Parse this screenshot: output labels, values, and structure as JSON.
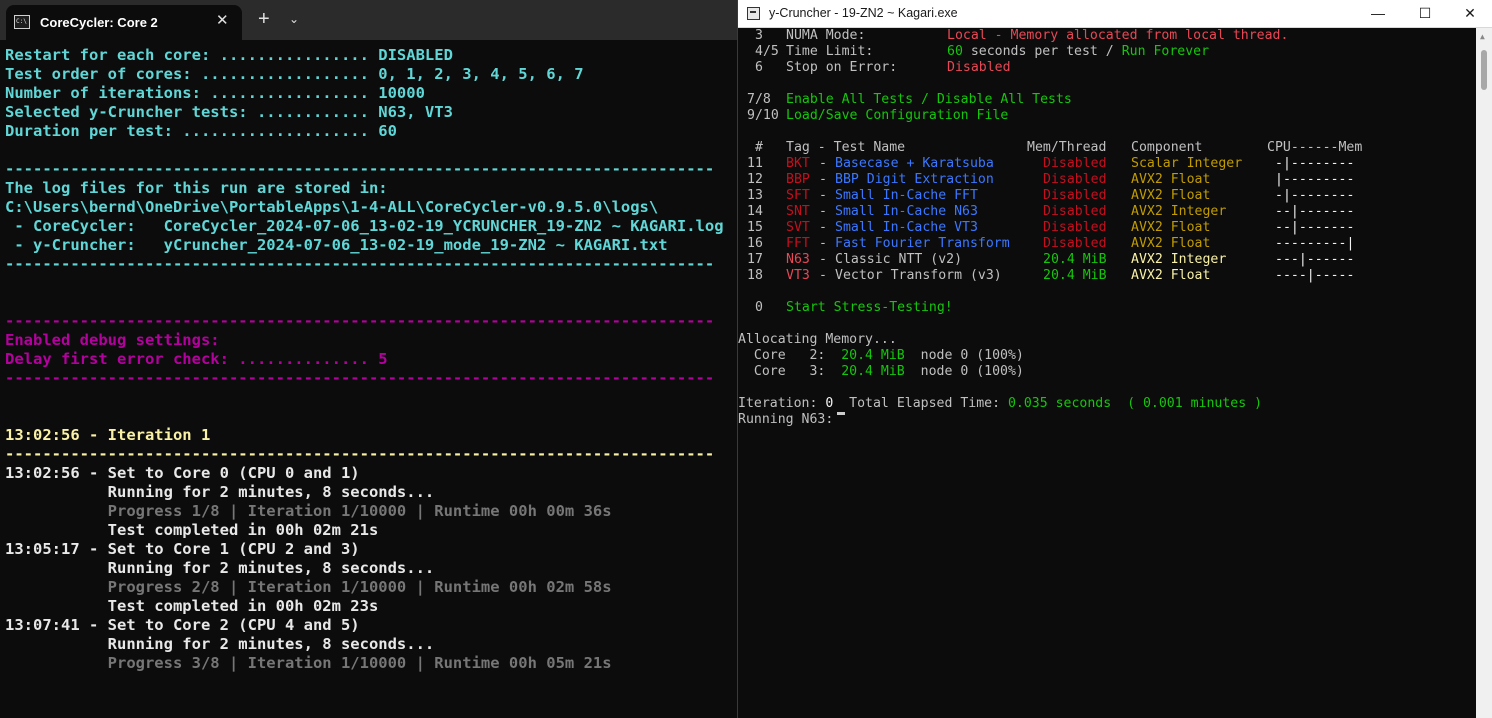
{
  "terminal": {
    "tab_title": "CoreCycler: Core 2",
    "tab_close_glyph": "✕",
    "new_tab_glyph": "+",
    "dropdown_glyph": "⌄",
    "lines": [
      {
        "t": "Restart for each core: ................ DISABLED",
        "c": "cyan"
      },
      {
        "t": "Test order of cores: .................. 0, 1, 2, 3, 4, 5, 6, 7",
        "c": "cyan"
      },
      {
        "t": "Number of iterations: ................. 10000",
        "c": "cyan"
      },
      {
        "t": "Selected y-Cruncher tests: ............ N63, VT3",
        "c": "cyan"
      },
      {
        "t": "Duration per test: .................... 60",
        "c": "cyan"
      },
      {
        "t": "",
        "c": "cyan"
      },
      {
        "t": "----------------------------------------------------------------------------",
        "c": "cyan"
      },
      {
        "t": "The log files for this run are stored in:",
        "c": "cyan"
      },
      {
        "t": "C:\\Users\\bernd\\OneDrive\\PortableApps\\1-4-ALL\\CoreCycler-v0.9.5.0\\logs\\",
        "c": "cyan"
      },
      {
        "t": " - CoreCycler:   CoreCycler_2024-07-06_13-02-19_YCRUNCHER_19-ZN2 ~ KAGARI.log",
        "c": "cyan"
      },
      {
        "t": " - y-Cruncher:   yCruncher_2024-07-06_13-02-19_mode_19-ZN2 ~ KAGARI.txt",
        "c": "cyan"
      },
      {
        "t": "----------------------------------------------------------------------------",
        "c": "cyan"
      },
      {
        "t": "",
        "c": "cyan"
      },
      {
        "t": "",
        "c": "cyan"
      },
      {
        "t": "----------------------------------------------------------------------------",
        "c": "mag"
      },
      {
        "t": "Enabled debug settings:",
        "c": "mag"
      },
      {
        "t": "Delay first error check: .............. 5",
        "c": "mag"
      },
      {
        "t": "----------------------------------------------------------------------------",
        "c": "mag"
      },
      {
        "t": "",
        "c": "white"
      },
      {
        "t": "",
        "c": "white"
      },
      {
        "t": "13:02:56 - Iteration 1",
        "c": "yel"
      },
      {
        "t": "----------------------------------------------------------------------------",
        "c": "yel"
      },
      {
        "t": "13:02:56 - Set to Core 0 (CPU 0 and 1)",
        "c": "white"
      },
      {
        "t": "           Running for 2 minutes, 8 seconds...",
        "c": "white"
      },
      {
        "t": "           Progress 1/8 | Iteration 1/10000 | Runtime 00h 00m 36s",
        "c": "grey"
      },
      {
        "t": "           Test completed in 00h 02m 21s",
        "c": "white"
      },
      {
        "t": "13:05:17 - Set to Core 1 (CPU 2 and 3)",
        "c": "white"
      },
      {
        "t": "           Running for 2 minutes, 8 seconds...",
        "c": "white"
      },
      {
        "t": "           Progress 2/8 | Iteration 1/10000 | Runtime 00h 02m 58s",
        "c": "grey"
      },
      {
        "t": "           Test completed in 00h 02m 23s",
        "c": "white"
      },
      {
        "t": "13:07:41 - Set to Core 2 (CPU 4 and 5)",
        "c": "white"
      },
      {
        "t": "           Running for 2 minutes, 8 seconds...",
        "c": "white"
      },
      {
        "t": "           Progress 3/8 | Iteration 1/10000 | Runtime 00h 05m 21s",
        "c": "grey"
      }
    ]
  },
  "ycruncher": {
    "window_title": "y-Cruncher - 19-ZN2 ~ Kagari.exe",
    "controls": {
      "minimize": "—",
      "maximize": "☐",
      "close": "✕"
    },
    "settings": [
      {
        "num": "3",
        "label": "NUMA Mode:",
        "value": "Local - Memory allocated from local thread.",
        "value_color": "r"
      },
      {
        "num": "4/5",
        "label": "Time Limit:",
        "value_a": "60",
        "value_b": " seconds per test / ",
        "value_c": "Run Forever"
      },
      {
        "num": "6",
        "label": "Stop on Error:",
        "value": "Disabled",
        "value_color": "r"
      }
    ],
    "options": [
      {
        "num": "7/8",
        "label": "Enable All Tests / Disable All Tests"
      },
      {
        "num": "9/10",
        "label": "Load/Save Configuration File"
      }
    ],
    "header": {
      "num": "#",
      "tag": "Tag - Test Name",
      "mem": "Mem/Thread",
      "comp": "Component",
      "bar": "CPU------Mem"
    },
    "tests": [
      {
        "num": "11",
        "tag": "BKT",
        "name": "Basecase + Karatsuba",
        "mem": "Disabled",
        "comp": "Scalar Integer",
        "bar": "-|--------",
        "enabled": false
      },
      {
        "num": "12",
        "tag": "BBP",
        "name": "BBP Digit Extraction",
        "mem": "Disabled",
        "comp": "AVX2 Float",
        "bar": "|---------",
        "enabled": false
      },
      {
        "num": "13",
        "tag": "SFT",
        "name": "Small In-Cache FFT",
        "mem": "Disabled",
        "comp": "AVX2 Float",
        "bar": "-|--------",
        "enabled": false
      },
      {
        "num": "14",
        "tag": "SNT",
        "name": "Small In-Cache N63",
        "mem": "Disabled",
        "comp": "AVX2 Integer",
        "bar": "--|-------",
        "enabled": false
      },
      {
        "num": "15",
        "tag": "SVT",
        "name": "Small In-Cache VT3",
        "mem": "Disabled",
        "comp": "AVX2 Float",
        "bar": "--|-------",
        "enabled": false
      },
      {
        "num": "16",
        "tag": "FFT",
        "name": "Fast Fourier Transform",
        "mem": "Disabled",
        "comp": "AVX2 Float",
        "bar": "---------|",
        "enabled": false
      },
      {
        "num": "17",
        "tag": "N63",
        "name": "Classic NTT (v2)",
        "mem": "20.4 MiB",
        "comp": "AVX2 Integer",
        "bar": "---|------",
        "enabled": true
      },
      {
        "num": "18",
        "tag": "VT3",
        "name": "Vector Transform (v3)",
        "mem": "20.4 MiB",
        "comp": "AVX2 Float",
        "bar": "----|-----",
        "enabled": true
      }
    ],
    "start": {
      "num": "0",
      "label": "Start Stress-Testing!"
    },
    "allocating": "Allocating Memory...",
    "cores": [
      {
        "label": "  Core   2:  ",
        "mem": "20.4 MiB",
        "node": "  node 0 (100%)"
      },
      {
        "label": "  Core   3:  ",
        "mem": "20.4 MiB",
        "node": "  node 0 (100%)"
      }
    ],
    "iteration": {
      "label": "Iteration: ",
      "value": "0",
      "elapsed_label": "  Total Elapsed Time: ",
      "seconds": "0.035 seconds",
      "minutes": "  ( 0.001 minutes )"
    },
    "running": "Running N63:"
  },
  "colors": {
    "cyan": "#61d6d6",
    "magenta": "#b4009e",
    "yellow": "#f9f1a5",
    "red": "#e74856",
    "green": "#16c60c",
    "blue": "#3b78ff",
    "dark_yellow": "#c19c00"
  }
}
